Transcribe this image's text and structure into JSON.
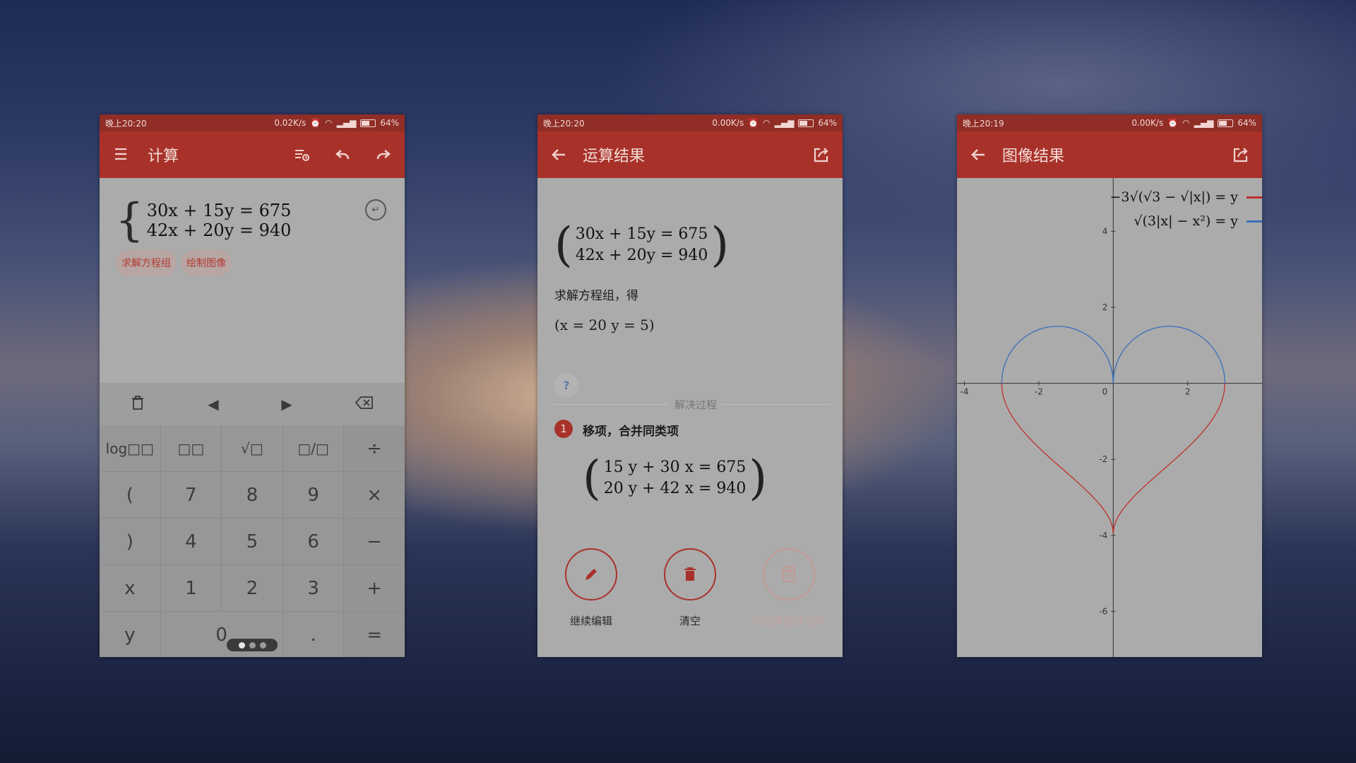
{
  "phone1": {
    "status": {
      "time": "晚上20:20",
      "speed": "0.02K/s",
      "battery": "64%"
    },
    "toolbar": {
      "title": "计算",
      "menu_icon": "menu-icon",
      "history_icon": "history-icon",
      "undo_icon": "undo-icon",
      "redo_icon": "redo-icon"
    },
    "equations": [
      "30x + 15y = 675",
      "42x + 20y = 940"
    ],
    "enter_icon": "enter-icon",
    "chips": [
      "求解方程组",
      "绘制图像"
    ],
    "edit_bar": {
      "trash_icon": "trash-icon",
      "left_icon": "left-arrow-icon",
      "right_icon": "right-arrow-icon",
      "backspace_icon": "backspace-icon"
    },
    "keys": [
      [
        "log□□",
        "□□",
        "√□",
        "□/□",
        "÷"
      ],
      [
        "(",
        "7",
        "8",
        "9",
        "×"
      ],
      [
        ")",
        "4",
        "5",
        "6",
        "−"
      ],
      [
        "x",
        "1",
        "2",
        "3",
        "+"
      ],
      [
        "y",
        "0",
        "",
        ".",
        "="
      ]
    ]
  },
  "phone2": {
    "status": {
      "time": "晚上20:20",
      "speed": "0.00K/s",
      "battery": "64%"
    },
    "toolbar": {
      "title": "运算结果",
      "back_icon": "back-arrow-icon",
      "share_icon": "share-icon"
    },
    "system": [
      "30x + 15y = 675",
      "42x + 20y = 940"
    ],
    "solve_text": "求解方程组，得",
    "solution": "(x = 20    y = 5)",
    "help_label": "?",
    "process_label": "解决过程",
    "step_number": "1",
    "step_title": "移项，合并同类项",
    "step_system": [
      "15 y + 30 x = 675",
      "20 y + 42 x = 940"
    ],
    "actions": [
      {
        "icon": "pencil-icon",
        "label": "继续编辑"
      },
      {
        "icon": "trash-icon",
        "label": "清空"
      },
      {
        "icon": "calculator-icon",
        "label": "用结果继续运算"
      }
    ]
  },
  "phone3": {
    "status": {
      "time": "晚上20:19",
      "speed": "0.00K/s",
      "battery": "64%"
    },
    "toolbar": {
      "title": "图像结果",
      "back_icon": "back-arrow-icon",
      "share_icon": "share-icon"
    },
    "legend": [
      {
        "text": "−3√(√3 − √|x|) = y",
        "color": "#c0302a"
      },
      {
        "text": "√(3|x| − x²) = y",
        "color": "#3a6fb8"
      }
    ],
    "chart_data": {
      "type": "line",
      "xlim": [
        -4.2,
        4
      ],
      "ylim": [
        -7.2,
        5.4
      ],
      "x_ticks": [
        "-4",
        "-2",
        "0",
        "2"
      ],
      "y_ticks": [
        "4",
        "2",
        "-2",
        "-4",
        "-6"
      ],
      "series": [
        {
          "name": "−3√(√3 − √|x|) = y",
          "color": "#c0302a",
          "function": "y = -3*sqrt(sqrt(3) - sqrt(|x|))",
          "x_range": [
            -3,
            3
          ]
        },
        {
          "name": "√(3|x| − x²) = y",
          "color": "#3a6fb8",
          "function": "y = sqrt(3|x| - x^2)",
          "x_range": [
            -3,
            3
          ]
        }
      ]
    }
  }
}
